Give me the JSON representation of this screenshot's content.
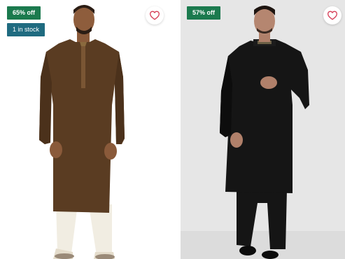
{
  "products": [
    {
      "discount_badge": "65% off",
      "stock_badge": "1 in stock",
      "wishlist_icon": "heart-outline-icon",
      "kurta_color": "#5a3c22",
      "pants_color": "#f1ede2"
    },
    {
      "discount_badge": "57% off",
      "wishlist_icon": "heart-outline-icon",
      "kurta_color": "#151515",
      "pants_color": "#151515"
    }
  ],
  "colors": {
    "discount_badge": "#1b7a4e",
    "stock_badge": "#1f6b80",
    "wishlist_heart": "#d63e57"
  }
}
